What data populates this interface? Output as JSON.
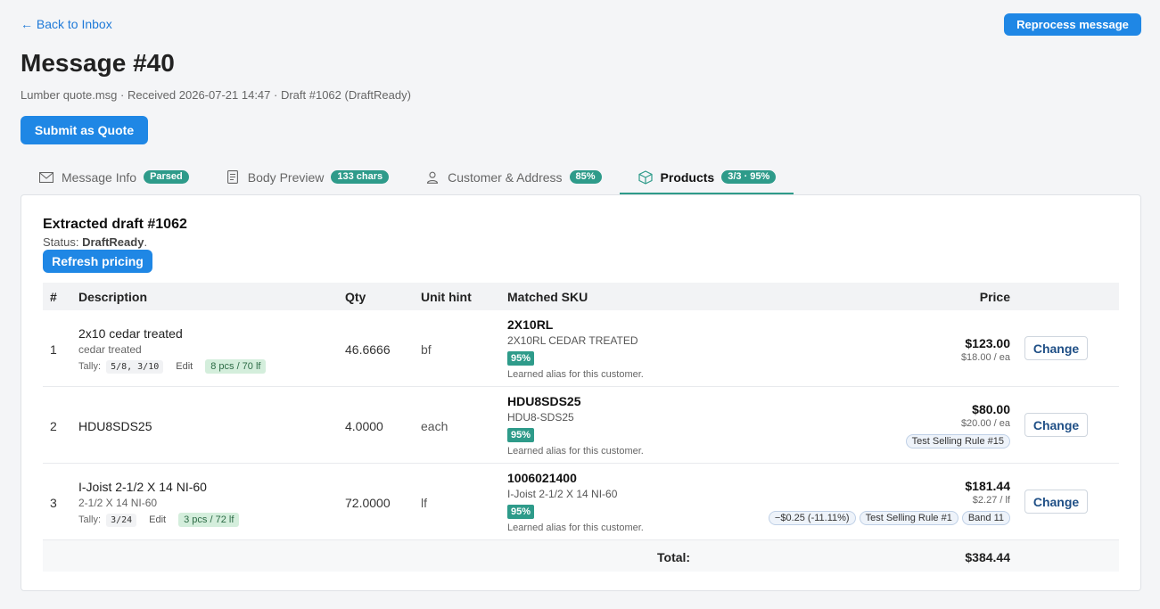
{
  "nav": {
    "back_label": "← Back to Inbox",
    "reprocess_label": "Reprocess message"
  },
  "header": {
    "title": "Message #40",
    "subtitle": "Lumber quote.msg · Received 2026-07-21 14:47 · Draft #1062 (DraftReady)",
    "submit_label": "Submit as Quote"
  },
  "tabs": [
    {
      "label": "Message Info",
      "badge": "Parsed",
      "icon": "envelope-icon"
    },
    {
      "label": "Body Preview",
      "badge": "133 chars",
      "icon": "document-icon"
    },
    {
      "label": "Customer & Address",
      "badge": "85%",
      "icon": "user-icon"
    },
    {
      "label": "Products",
      "badge": "3/3 · 95%",
      "icon": "box-icon",
      "active": true
    }
  ],
  "draft": {
    "title": "Extracted draft #1062",
    "status_prefix": "Status: ",
    "status_value": "DraftReady",
    "status_suffix": ".",
    "refresh_label": "Refresh pricing"
  },
  "table": {
    "headers": {
      "num": "#",
      "description": "Description",
      "qty": "Qty",
      "unit": "Unit hint",
      "sku": "Matched SKU",
      "price": "Price"
    },
    "rows": [
      {
        "num": "1",
        "description": "2x10 cedar treated",
        "sub": "cedar treated",
        "tally_label": "Tally:",
        "tally_code": "5/8, 3/10",
        "edit_label": "Edit",
        "tally_pill": "8 pcs / 70 lf",
        "qty": "46.6666",
        "unit": "bf",
        "sku_code": "2X10RL",
        "sku_desc": "2X10RL CEDAR TREATED",
        "match": "95%",
        "note": "Learned alias for this customer.",
        "price": "$123.00",
        "unit_price": "$18.00 / ea",
        "rules": [],
        "change_label": "Change"
      },
      {
        "num": "2",
        "description": "HDU8SDS25",
        "sub": "",
        "tally_label": "",
        "tally_code": "",
        "edit_label": "",
        "tally_pill": "",
        "qty": "4.0000",
        "unit": "each",
        "sku_code": "HDU8SDS25",
        "sku_desc": "HDU8-SDS25",
        "match": "95%",
        "note": "Learned alias for this customer.",
        "price": "$80.00",
        "unit_price": "$20.00 / ea",
        "rules": [
          "Test Selling Rule #15"
        ],
        "change_label": "Change"
      },
      {
        "num": "3",
        "description": "I-Joist 2-1/2 X 14 NI-60",
        "sub": "2-1/2 X 14 NI-60",
        "tally_label": "Tally:",
        "tally_code": "3/24",
        "edit_label": "Edit",
        "tally_pill": "3 pcs / 72 lf",
        "qty": "72.0000",
        "unit": "lf",
        "sku_code": "1006021400",
        "sku_desc": "I-Joist 2-1/2 X 14 NI-60",
        "match": "95%",
        "note": "Learned alias for this customer.",
        "price": "$181.44",
        "unit_price": "$2.27 / lf",
        "rules": [
          "−$0.25 (-11.11%)",
          "Test Selling Rule #1",
          "Band 11"
        ],
        "change_label": "Change"
      }
    ],
    "total_label": "Total:",
    "total_value": "$384.44"
  },
  "colors": {
    "primary": "#1f87e5",
    "accent": "#2e9b8a",
    "link": "#1f7ad8"
  }
}
